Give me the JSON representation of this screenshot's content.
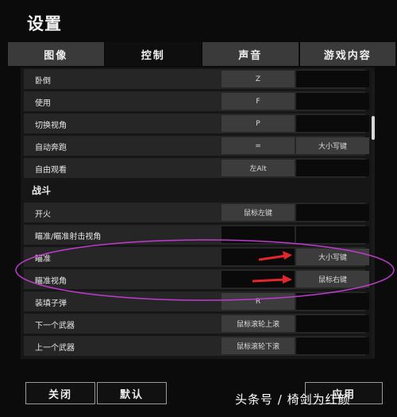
{
  "window": {
    "title": "设置"
  },
  "tabs": [
    {
      "label": "图像",
      "active": false
    },
    {
      "label": "控制",
      "active": true
    },
    {
      "label": "声音",
      "active": false
    },
    {
      "label": "游戏内容",
      "active": false
    }
  ],
  "rows_top": [
    {
      "label": "卧倒",
      "primary": "Z",
      "secondary": ""
    },
    {
      "label": "使用",
      "primary": "F",
      "secondary": ""
    },
    {
      "label": "切换视角",
      "primary": "P",
      "secondary": ""
    },
    {
      "label": "自动奔跑",
      "primary": "=",
      "secondary": "大小写键"
    },
    {
      "label": "自由观看",
      "primary": "左Alt",
      "secondary": ""
    }
  ],
  "section": {
    "label": "战斗"
  },
  "rows_combat": [
    {
      "label": "开火",
      "primary": "鼠标左键",
      "secondary": ""
    },
    {
      "label": "瞄准/瞄准射击视角",
      "primary": "",
      "secondary": ""
    },
    {
      "label": "瞄准",
      "primary": "",
      "secondary": "大小写键"
    },
    {
      "label": "瞄准视角",
      "primary": "",
      "secondary": "鼠标右键"
    },
    {
      "label": "装填子弹",
      "primary": "R",
      "secondary": ""
    },
    {
      "label": "下一个武器",
      "primary": "鼠标滚轮上滚",
      "secondary": ""
    },
    {
      "label": "上一个武器",
      "primary": "鼠标滚轮下滚",
      "secondary": ""
    }
  ],
  "buttons": {
    "close": "关闭",
    "default": "默认",
    "apply": "应用"
  },
  "watermark": "头条号 / 椅剑为红颜",
  "annotation_color": "#c13ad1",
  "arrow_color": "#e0282c"
}
